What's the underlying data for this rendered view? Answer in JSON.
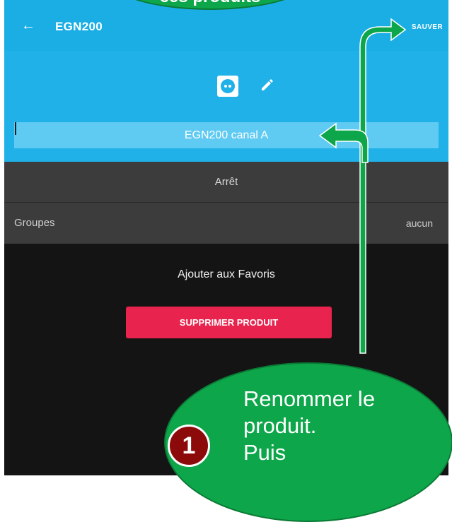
{
  "toolbar": {
    "back_icon": "arrow-left-icon",
    "title": "EGN200",
    "save_label": "SAUVER"
  },
  "header": {
    "socket_icon": "power-socket-icon",
    "edit_icon": "pencil-icon",
    "name_value": "EGN200 canal A"
  },
  "rows": {
    "state_label": "Arrêt",
    "groups_label": "Groupes",
    "groups_value": "aucun"
  },
  "actions": {
    "favorites_label": "Ajouter aux Favoris",
    "delete_label": "SUPPRIMER PRODUIT"
  },
  "annotations": {
    "top_bubble_text": "ces produits",
    "bubble_text": [
      "Renommer le",
      "produit.",
      "Puis"
    ],
    "step_number": "1",
    "colors": {
      "bubble": "#0ea64a",
      "arrow": "#0ea64a",
      "badge": "#8c0a0a",
      "accent": "#1fb1e8",
      "danger": "#e8234d"
    }
  }
}
